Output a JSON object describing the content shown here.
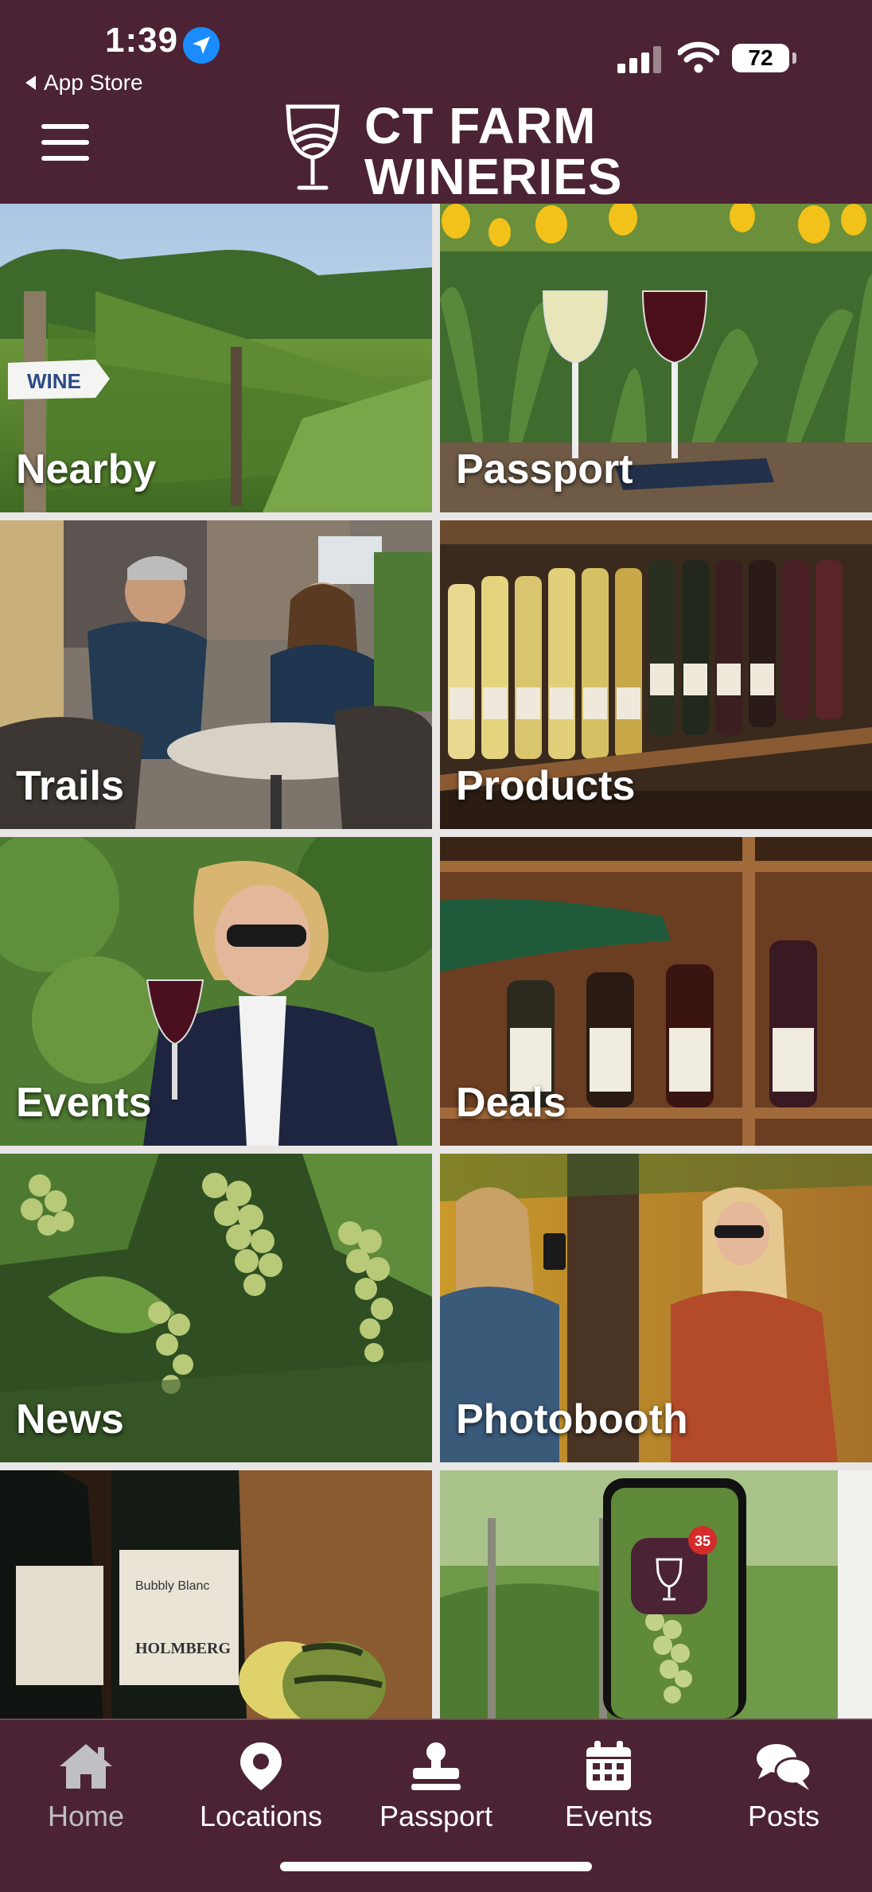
{
  "status_bar": {
    "time": "1:39",
    "back_app": "App Store",
    "battery": "72"
  },
  "header": {
    "logo_line1": "CT FARM",
    "logo_line2": "WINERIES"
  },
  "tiles": [
    {
      "label": "Nearby",
      "sign": "WINE"
    },
    {
      "label": "Passport"
    },
    {
      "label": "Trails"
    },
    {
      "label": "Products"
    },
    {
      "label": "Events"
    },
    {
      "label": "Deals"
    },
    {
      "label": "News"
    },
    {
      "label": "Photobooth"
    },
    {
      "label": "",
      "bottle_brand": "HOLMBERG",
      "bottle_label": "Bubbly Blanc"
    },
    {
      "label": "",
      "badge": "35"
    }
  ],
  "tabbar": [
    {
      "label": "Home",
      "icon": "home-icon",
      "active": true
    },
    {
      "label": "Locations",
      "icon": "map-pin-icon"
    },
    {
      "label": "Passport",
      "icon": "stamp-icon"
    },
    {
      "label": "Events",
      "icon": "calendar-icon"
    },
    {
      "label": "Posts",
      "icon": "chat-bubbles-icon"
    }
  ],
  "colors": {
    "brand": "#4b2335",
    "tab_active": "#bfbfc4",
    "location_badge": "#1a8cff"
  }
}
